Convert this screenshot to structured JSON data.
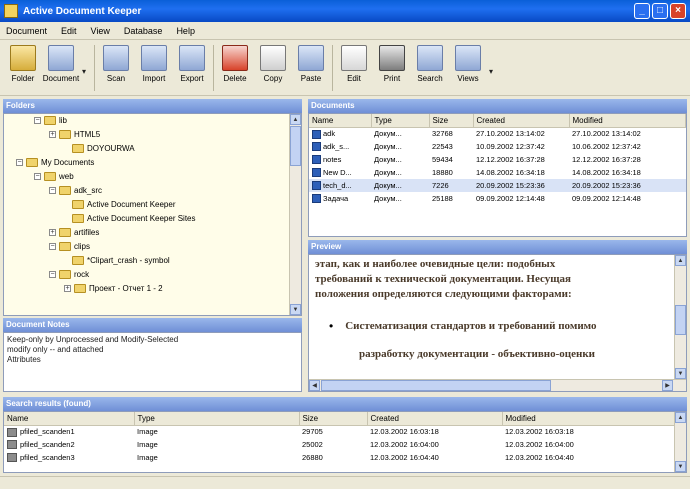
{
  "window": {
    "title": "Active Document Keeper"
  },
  "menu": [
    "Document",
    "Edit",
    "View",
    "Database",
    "Help"
  ],
  "toolbar": [
    {
      "label": "Folder",
      "icon": "folder-add-icon"
    },
    {
      "label": "Document",
      "icon": "document-add-icon"
    },
    {
      "label": "Scan",
      "icon": "scanner-icon"
    },
    {
      "label": "Import",
      "icon": "import-icon"
    },
    {
      "label": "Export",
      "icon": "export-icon"
    },
    {
      "label": "Delete",
      "icon": "delete-icon"
    },
    {
      "label": "Copy",
      "icon": "copy-icon"
    },
    {
      "label": "Paste",
      "icon": "paste-icon"
    },
    {
      "label": "Edit",
      "icon": "edit-icon"
    },
    {
      "label": "Print",
      "icon": "printer-icon"
    },
    {
      "label": "Search",
      "icon": "search-icon"
    },
    {
      "label": "Views",
      "icon": "views-icon"
    }
  ],
  "folders_panel": {
    "title": "Folders",
    "items": [
      {
        "label": "lib"
      },
      {
        "label": "HTML5"
      },
      {
        "label": "DOYOURWA"
      },
      {
        "label": "My Documents"
      },
      {
        "label": "web"
      },
      {
        "label": "adk_src"
      },
      {
        "label": "Active Document Keeper"
      },
      {
        "label": "Active Document Keeper Sites"
      },
      {
        "label": "artifiles"
      },
      {
        "label": "clips"
      },
      {
        "label": "*Clipart_crash - symbol"
      },
      {
        "label": "rock"
      },
      {
        "label": "Проект - Отчет 1 - 2"
      }
    ]
  },
  "notes_panel": {
    "title": "Document Notes",
    "text": "Keep-only by Unprocessed and Modify-Selected\nmodify only -- and attached\nAttributes"
  },
  "documents_panel": {
    "title": "Documents",
    "columns": [
      "Name",
      "Type",
      "Size",
      "Created",
      "Modified"
    ],
    "rows": [
      {
        "name": "adk",
        "type": "Докум...",
        "size": "32768",
        "created": "27.10.2002 13:14:02",
        "modified": "27.10.2002 13:14:02"
      },
      {
        "name": "adk_s...",
        "type": "Докум...",
        "size": "22543",
        "created": "10.09.2002 12:37:42",
        "modified": "10.06.2002 12:37:42"
      },
      {
        "name": "notes",
        "type": "Докум...",
        "size": "59434",
        "created": "12.12.2002 16:37:28",
        "modified": "12.12.2002 16:37:28"
      },
      {
        "name": "New D...",
        "type": "Докум...",
        "size": "18880",
        "created": "14.08.2002 16:34:18",
        "modified": "14.08.2002 16:34:18"
      },
      {
        "name": "tech_d...",
        "type": "Докум...",
        "size": "7226",
        "created": "20.09.2002 15:23:36",
        "modified": "20.09.2002 15:23:36"
      },
      {
        "name": "Задача",
        "type": "Докум...",
        "size": "25188",
        "created": "09.09.2002 12:14:48",
        "modified": "09.09.2002 12:14:48"
      }
    ]
  },
  "preview_panel": {
    "title": "Preview",
    "lines": [
      "этап, как и наиболее очевидные цели: подобных",
      "требований к технической документации. Несущая",
      "положения определяются следующими факторами:",
      "Систематизация стандартов и требований помимо",
      "разработку документации - объективно-оценки"
    ],
    "bullet": "•"
  },
  "search_panel": {
    "title": "Search results (found)",
    "columns": [
      "Name",
      "Type",
      "Size",
      "Created",
      "Modified"
    ],
    "rows": [
      {
        "name": "pfiled_scanden1",
        "type": "Image",
        "size": "29705",
        "created": "12.03.2002 16:03:18",
        "modified": "12.03.2002 16:03:18"
      },
      {
        "name": "pfiled_scanden2",
        "type": "Image",
        "size": "25002",
        "created": "12.03.2002 16:04:00",
        "modified": "12.03.2002 16:04:00"
      },
      {
        "name": "pfiled_scanden3",
        "type": "Image",
        "size": "26880",
        "created": "12.03.2002 16:04:40",
        "modified": "12.03.2002 16:04:40"
      }
    ]
  }
}
